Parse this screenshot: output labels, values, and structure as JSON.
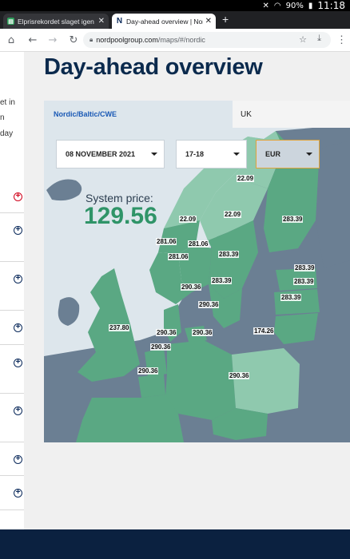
{
  "status_bar": {
    "battery": "90%",
    "time": "11:18"
  },
  "tabs": [
    {
      "title": "Elprisrekordet slaget igen p",
      "favicon": "green-doc-icon"
    },
    {
      "title": "Day-ahead overview | Nord P",
      "favicon": "nordpool-n-icon"
    }
  ],
  "toolbar": {
    "url_host": "nordpoolgroup.com",
    "url_path": "/maps/#/nordic"
  },
  "left_fragments": [
    "et in",
    "n",
    "day"
  ],
  "page": {
    "heading": "Day-ahead overview",
    "region_tabs": [
      "Nordic/Baltic/CWE",
      "UK"
    ],
    "date": "08 NOVEMBER 2021",
    "hour": "17-18",
    "currency": "EUR",
    "system_price_label": "System price:",
    "system_price_value": "129.56"
  },
  "prices": {
    "se1": "22.09",
    "se2": "22.09",
    "no4": "22.09",
    "fi": "283.39",
    "no3": "281.06",
    "no1": "281.06",
    "no2": "281.06",
    "se3": "283.39",
    "se4": "283.39",
    "ee": "283.39",
    "lv": "283.39",
    "lt": "283.39",
    "dk1": "290.36",
    "dk2": "290.36",
    "gb": "237.80",
    "nl": "290.36",
    "be": "290.36",
    "de": "290.36",
    "fr": "290.36",
    "at": "290.36",
    "pl": "174.26"
  },
  "colors": {
    "heading": "#0b2a4d",
    "system_price": "#2f9468",
    "accent_link": "#1a59b5",
    "land_other": "#6b7f93",
    "sea": "#dde6ec"
  }
}
